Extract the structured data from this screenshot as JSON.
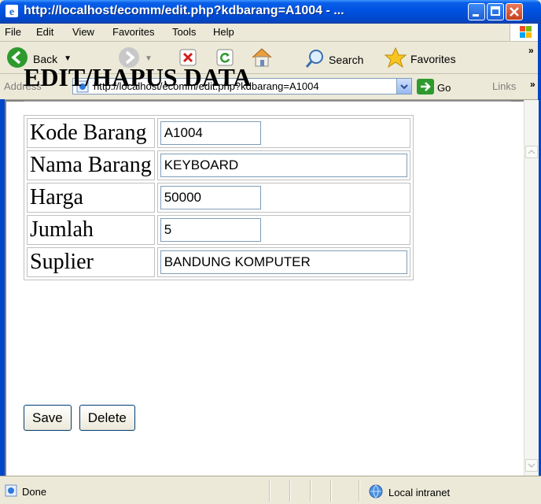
{
  "window": {
    "title": "http://localhost/ecomm/edit.php?kdbarang=A1004 - ..."
  },
  "menu": {
    "items": [
      "File",
      "Edit",
      "View",
      "Favorites",
      "Tools",
      "Help"
    ]
  },
  "toolbar": {
    "back_label": "Back",
    "search_label": "Search",
    "favorites_label": "Favorites"
  },
  "addressbar": {
    "label": "Address",
    "url": "http://localhost/ecomm/edit.php?kdbarang=A1004",
    "go_label": "Go",
    "links_label": "Links"
  },
  "page": {
    "heading": "EDIT/HAPUS DATA",
    "fields": [
      {
        "label": "Kode Barang",
        "value": "A1004"
      },
      {
        "label": "Nama Barang",
        "value": "KEYBOARD"
      },
      {
        "label": "Harga",
        "value": "50000"
      },
      {
        "label": "Jumlah",
        "value": "5"
      },
      {
        "label": "Suplier",
        "value": "BANDUNG KOMPUTER"
      }
    ],
    "save_label": "Save",
    "delete_label": "Delete"
  },
  "status": {
    "text": "Done",
    "zone": "Local intranet"
  }
}
